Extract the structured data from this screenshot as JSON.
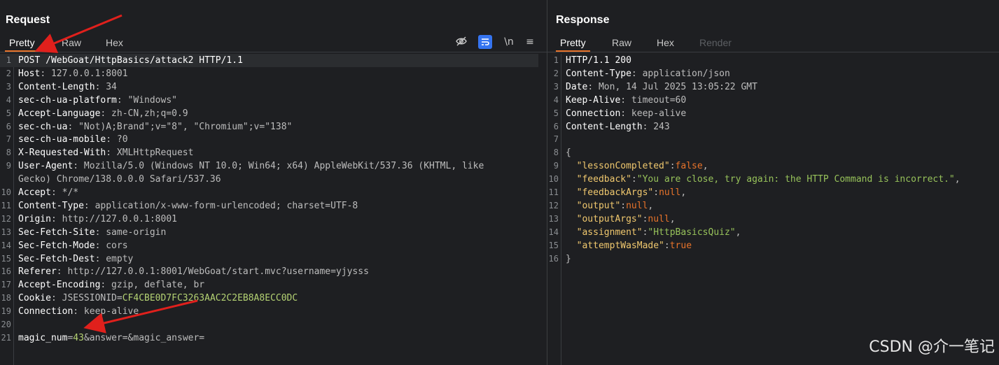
{
  "request": {
    "title": "Request",
    "tabs": [
      "Pretty",
      "Raw",
      "Hex"
    ],
    "tools": [
      "\\n",
      "≡"
    ],
    "lines": [
      {
        "n": "1",
        "parts": [
          {
            "t": "POST /WebGoat/HttpBasics/attack2 HTTP/1.1",
            "c": "k"
          }
        ]
      },
      {
        "n": "2",
        "parts": [
          {
            "t": "Host",
            "c": "k"
          },
          {
            "t": ": 127.0.0.1:8001",
            "c": "v"
          }
        ]
      },
      {
        "n": "3",
        "parts": [
          {
            "t": "Content-Length",
            "c": "k"
          },
          {
            "t": ": 34",
            "c": "v"
          }
        ]
      },
      {
        "n": "4",
        "parts": [
          {
            "t": "sec-ch-ua-platform",
            "c": "k"
          },
          {
            "t": ": \"Windows\"",
            "c": "v"
          }
        ]
      },
      {
        "n": "5",
        "parts": [
          {
            "t": "Accept-Language",
            "c": "k"
          },
          {
            "t": ": zh-CN,zh;q=0.9",
            "c": "v"
          }
        ]
      },
      {
        "n": "6",
        "parts": [
          {
            "t": "sec-ch-ua",
            "c": "k"
          },
          {
            "t": ": \"Not)A;Brand\";v=\"8\", \"Chromium\";v=\"138\"",
            "c": "v"
          }
        ]
      },
      {
        "n": "7",
        "parts": [
          {
            "t": "sec-ch-ua-mobile",
            "c": "k"
          },
          {
            "t": ": ?0",
            "c": "v"
          }
        ]
      },
      {
        "n": "8",
        "parts": [
          {
            "t": "X-Requested-With",
            "c": "k"
          },
          {
            "t": ": XMLHttpRequest",
            "c": "v"
          }
        ]
      },
      {
        "n": "9",
        "parts": [
          {
            "t": "User-Agent",
            "c": "k"
          },
          {
            "t": ": Mozilla/5.0 (Windows NT 10.0; Win64; x64) AppleWebKit/537.36 (KHTML, like",
            "c": "v"
          }
        ]
      },
      {
        "n": "",
        "parts": [
          {
            "t": "Gecko) Chrome/138.0.0.0 Safari/537.36",
            "c": "v"
          }
        ]
      },
      {
        "n": "10",
        "parts": [
          {
            "t": "Accept",
            "c": "k"
          },
          {
            "t": ": */*",
            "c": "v"
          }
        ]
      },
      {
        "n": "11",
        "parts": [
          {
            "t": "Content-Type",
            "c": "k"
          },
          {
            "t": ": application/x-www-form-urlencoded; charset=UTF-8",
            "c": "v"
          }
        ]
      },
      {
        "n": "12",
        "parts": [
          {
            "t": "Origin",
            "c": "k"
          },
          {
            "t": ": http://127.0.0.1:8001",
            "c": "v"
          }
        ]
      },
      {
        "n": "13",
        "parts": [
          {
            "t": "Sec-Fetch-Site",
            "c": "k"
          },
          {
            "t": ": same-origin",
            "c": "v"
          }
        ]
      },
      {
        "n": "14",
        "parts": [
          {
            "t": "Sec-Fetch-Mode",
            "c": "k"
          },
          {
            "t": ": cors",
            "c": "v"
          }
        ]
      },
      {
        "n": "15",
        "parts": [
          {
            "t": "Sec-Fetch-Dest",
            "c": "k"
          },
          {
            "t": ": empty",
            "c": "v"
          }
        ]
      },
      {
        "n": "16",
        "parts": [
          {
            "t": "Referer",
            "c": "k"
          },
          {
            "t": ": http://127.0.0.1:8001/WebGoat/start.mvc?username=yjysss",
            "c": "v"
          }
        ]
      },
      {
        "n": "17",
        "parts": [
          {
            "t": "Accept-Encoding",
            "c": "k"
          },
          {
            "t": ": gzip, deflate, br",
            "c": "v"
          }
        ]
      },
      {
        "n": "18",
        "parts": [
          {
            "t": "Cookie",
            "c": "k"
          },
          {
            "t": ": JSESSIONID=",
            "c": "v"
          },
          {
            "t": "CF4CBE0D7FC3263AAC2C2EB8A8ECC0DC",
            "c": "g"
          }
        ]
      },
      {
        "n": "19",
        "parts": [
          {
            "t": "Connection",
            "c": "k"
          },
          {
            "t": ": keep-alive",
            "c": "v"
          }
        ]
      },
      {
        "n": "20",
        "parts": []
      },
      {
        "n": "21",
        "parts": [
          {
            "t": "magic_num",
            "c": "k"
          },
          {
            "t": "=",
            "c": "v"
          },
          {
            "t": "43",
            "c": "g"
          },
          {
            "t": "&answer=&magic_answer=",
            "c": "v"
          }
        ]
      }
    ]
  },
  "response": {
    "title": "Response",
    "tabs": [
      "Pretty",
      "Raw",
      "Hex",
      "Render"
    ],
    "lines": [
      {
        "n": "1",
        "parts": [
          {
            "t": "HTTP/1.1 200",
            "c": "k"
          }
        ]
      },
      {
        "n": "2",
        "parts": [
          {
            "t": "Content-Type",
            "c": "k"
          },
          {
            "t": ": application/json",
            "c": "v"
          }
        ]
      },
      {
        "n": "3",
        "parts": [
          {
            "t": "Date",
            "c": "k"
          },
          {
            "t": ": Mon, 14 Jul 2025 13:05:22 GMT",
            "c": "v"
          }
        ]
      },
      {
        "n": "4",
        "parts": [
          {
            "t": "Keep-Alive",
            "c": "k"
          },
          {
            "t": ": timeout=60",
            "c": "v"
          }
        ]
      },
      {
        "n": "5",
        "parts": [
          {
            "t": "Connection",
            "c": "k"
          },
          {
            "t": ": keep-alive",
            "c": "v"
          }
        ]
      },
      {
        "n": "6",
        "parts": [
          {
            "t": "Content-Length",
            "c": "k"
          },
          {
            "t": ": 243",
            "c": "v"
          }
        ]
      },
      {
        "n": "7",
        "parts": []
      },
      {
        "n": "8",
        "parts": [
          {
            "t": "{",
            "c": "v"
          }
        ]
      },
      {
        "n": "9",
        "parts": [
          {
            "t": "  \"lessonCompleted\"",
            "c": "jk"
          },
          {
            "t": ":",
            "c": "v"
          },
          {
            "t": "false",
            "c": "jb"
          },
          {
            "t": ",",
            "c": "v"
          }
        ]
      },
      {
        "n": "10",
        "parts": [
          {
            "t": "  \"feedback\"",
            "c": "jk"
          },
          {
            "t": ":",
            "c": "v"
          },
          {
            "t": "\"You are close, try again: the HTTP Command is incorrect.\"",
            "c": "js"
          },
          {
            "t": ",",
            "c": "v"
          }
        ]
      },
      {
        "n": "11",
        "parts": [
          {
            "t": "  \"feedbackArgs\"",
            "c": "jk"
          },
          {
            "t": ":",
            "c": "v"
          },
          {
            "t": "null",
            "c": "jb"
          },
          {
            "t": ",",
            "c": "v"
          }
        ]
      },
      {
        "n": "12",
        "parts": [
          {
            "t": "  \"output\"",
            "c": "jk"
          },
          {
            "t": ":",
            "c": "v"
          },
          {
            "t": "null",
            "c": "jb"
          },
          {
            "t": ",",
            "c": "v"
          }
        ]
      },
      {
        "n": "13",
        "parts": [
          {
            "t": "  \"outputArgs\"",
            "c": "jk"
          },
          {
            "t": ":",
            "c": "v"
          },
          {
            "t": "null",
            "c": "jb"
          },
          {
            "t": ",",
            "c": "v"
          }
        ]
      },
      {
        "n": "14",
        "parts": [
          {
            "t": "  \"assignment\"",
            "c": "jk"
          },
          {
            "t": ":",
            "c": "v"
          },
          {
            "t": "\"HttpBasicsQuiz\"",
            "c": "js"
          },
          {
            "t": ",",
            "c": "v"
          }
        ]
      },
      {
        "n": "15",
        "parts": [
          {
            "t": "  \"attemptWasMade\"",
            "c": "jk"
          },
          {
            "t": ":",
            "c": "v"
          },
          {
            "t": "true",
            "c": "jb"
          }
        ]
      },
      {
        "n": "16",
        "parts": [
          {
            "t": "}",
            "c": "v"
          }
        ]
      }
    ]
  },
  "watermark": "CSDN @介一笔记",
  "colors": {
    "accent": "#e8732a",
    "arrow": "#e0201c",
    "active_tool": "#3574f0"
  }
}
